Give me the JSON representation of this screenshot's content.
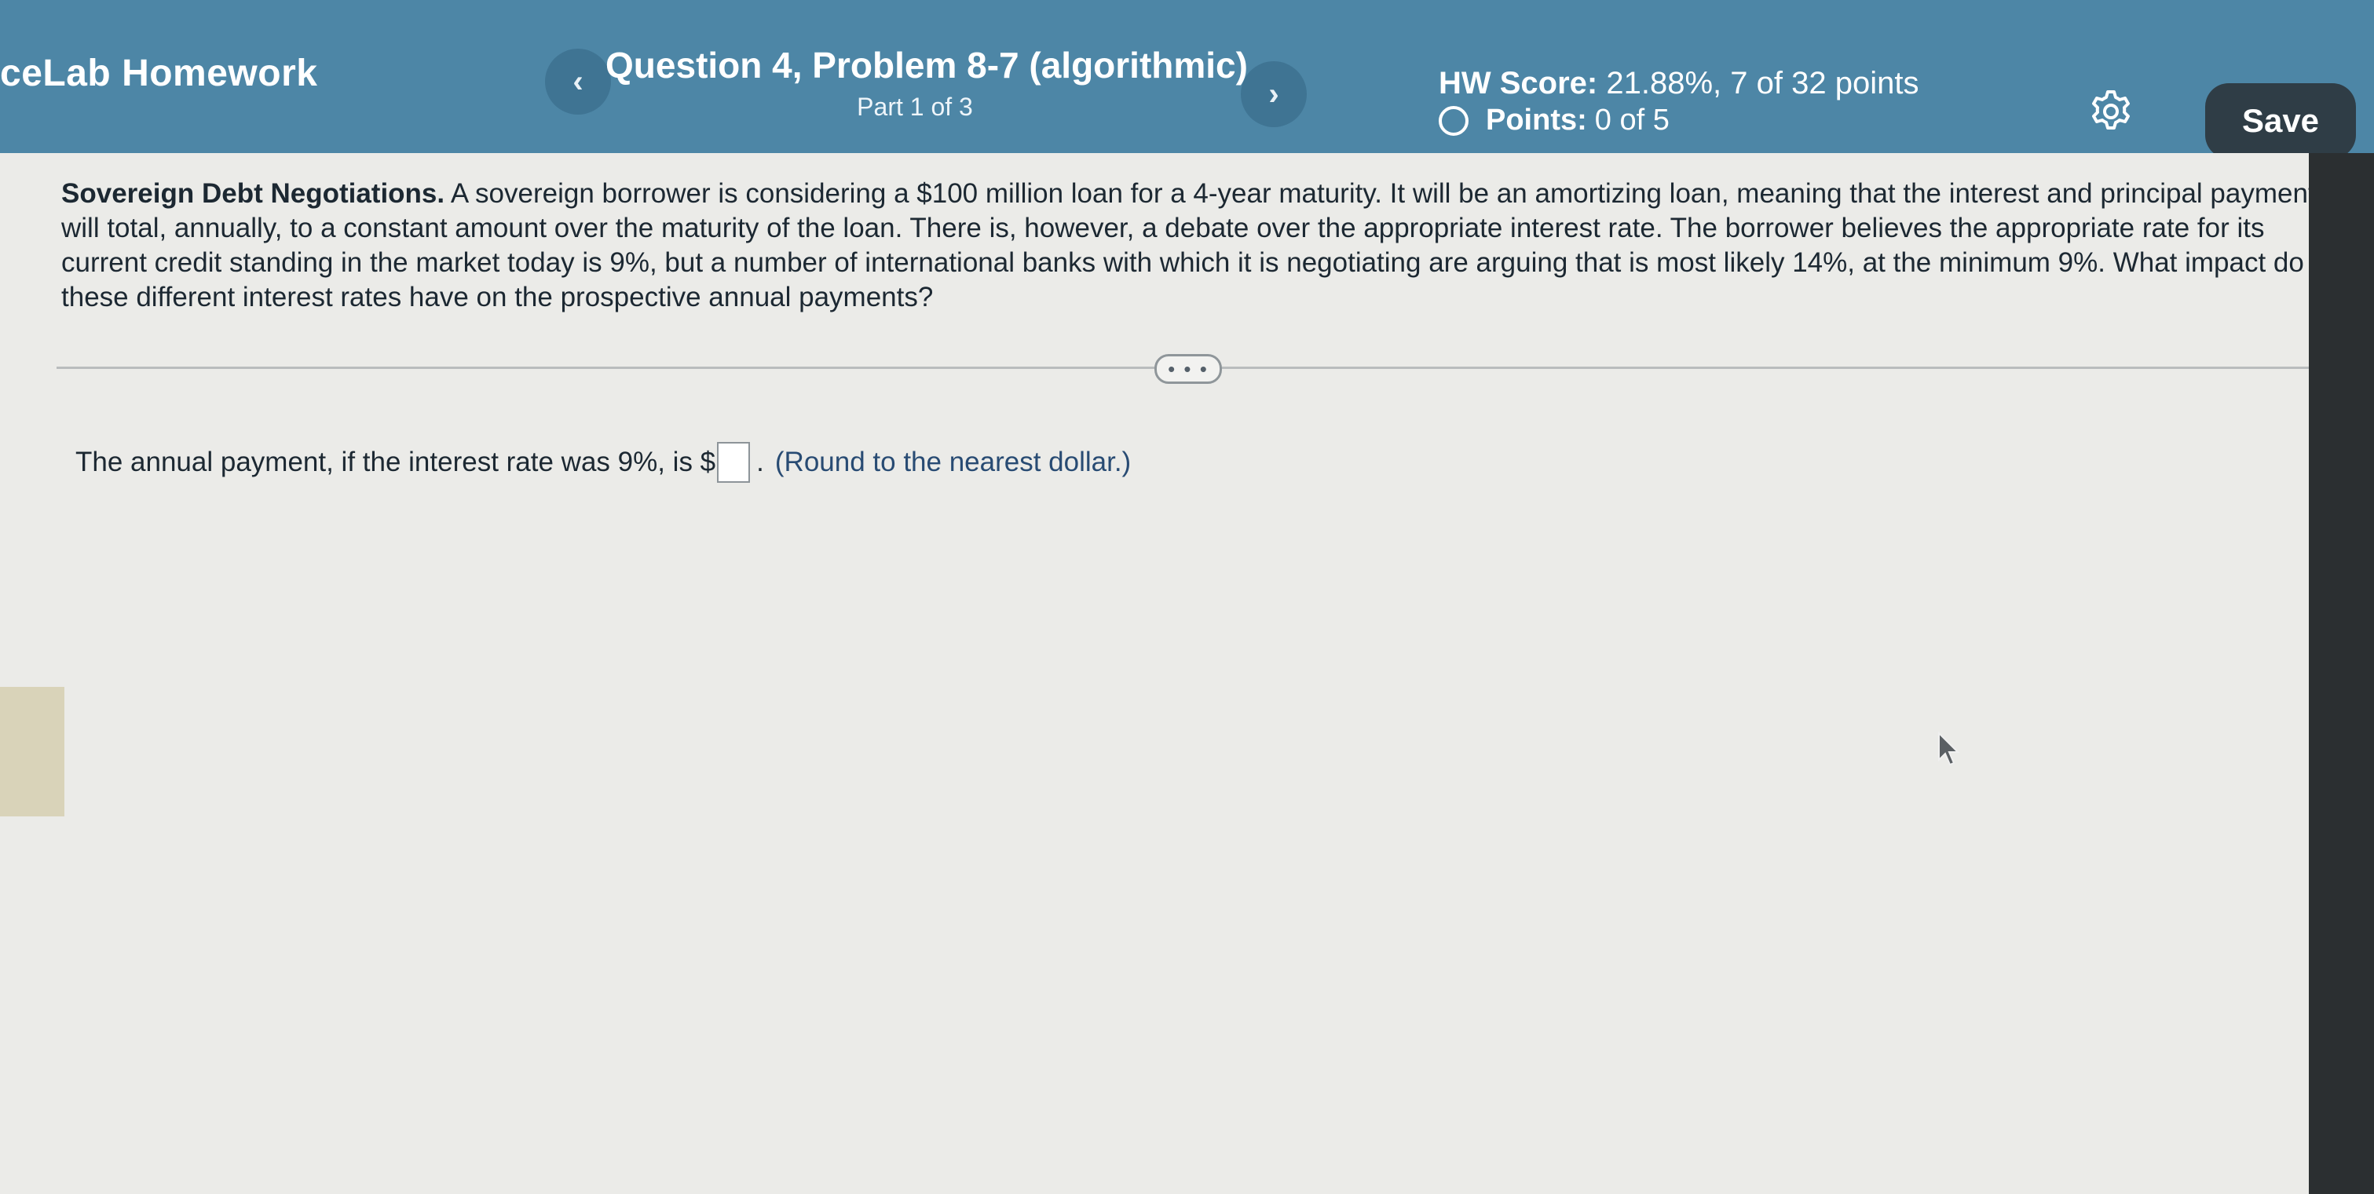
{
  "header": {
    "app_title": "ceLab Homework",
    "question_title": "Question 4, Problem 8-7 (algorithmic)",
    "part": "Part 1 of 3",
    "hw_score_label": "HW Score:",
    "hw_score_value": "21.88%, 7 of 32 points",
    "points_label": "Points:",
    "points_value": "0 of 5",
    "prev_icon": "‹",
    "next_icon": "›",
    "save_label": "Save"
  },
  "problem": {
    "title": "Sovereign Debt Negotiations.",
    "body": "A sovereign borrower is considering a $100 million loan for a 4-year maturity. It will be an amortizing loan, meaning that the interest and principal payments will total, annually, to a constant amount over the maturity of the loan. There is, however, a debate over the appropriate interest rate. The borrower believes the appropriate rate for its current credit standing in the market today is 9%, but a number of international banks with which it is negotiating are arguing that is most likely 14%, at the minimum 9%. What impact do these different interest rates have on the prospective annual payments?"
  },
  "expand_label": "• • •",
  "answer": {
    "prompt": "The annual payment, if the interest rate was 9%, is $",
    "value": "",
    "suffix": ".",
    "hint": "(Round to the nearest dollar.)"
  },
  "colors": {
    "header_bg": "#4d86a6",
    "save_bg": "#2f3d46",
    "hint_text": "#284b73"
  }
}
